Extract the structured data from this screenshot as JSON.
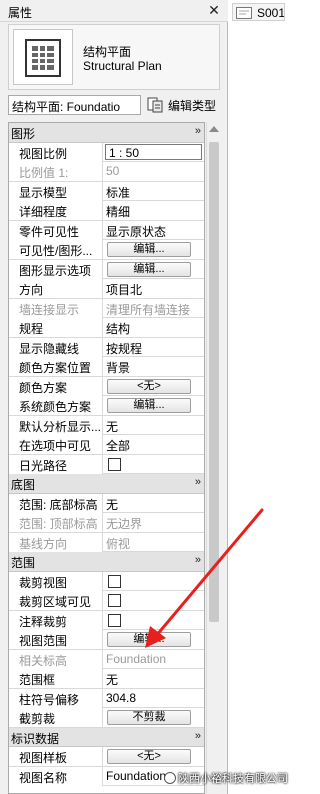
{
  "palette": {
    "title": "属性",
    "close_glyph": "✕",
    "type": {
      "line1": "结构平面",
      "line2": "Structural Plan"
    },
    "selector_value": "结构平面: Foundatio",
    "edit_type_label": "编辑类型"
  },
  "sections": {
    "graphics": {
      "title": "图形",
      "rows": [
        {
          "label": "视图比例",
          "value": "1 : 50"
        },
        {
          "label": "比例值 1:",
          "value": "50"
        },
        {
          "label": "显示模型",
          "value": "标准"
        },
        {
          "label": "详细程度",
          "value": "精细"
        },
        {
          "label": "零件可见性",
          "value": "显示原状态"
        },
        {
          "label": "可见性/图形...",
          "value": "编辑..."
        },
        {
          "label": "图形显示选项",
          "value": "编辑..."
        },
        {
          "label": "方向",
          "value": "项目北"
        },
        {
          "label": "墙连接显示",
          "value": "清理所有墙连接"
        },
        {
          "label": "规程",
          "value": "结构"
        },
        {
          "label": "显示隐藏线",
          "value": "按规程"
        },
        {
          "label": "颜色方案位置",
          "value": "背景"
        },
        {
          "label": "颜色方案",
          "value": "<无>"
        },
        {
          "label": "系统颜色方案",
          "value": "编辑..."
        },
        {
          "label": "默认分析显示...",
          "value": "无"
        },
        {
          "label": "在选项中可见",
          "value": "全部"
        },
        {
          "label": "日光路径",
          "value": ""
        }
      ]
    },
    "underlay": {
      "title": "底图",
      "rows": [
        {
          "label": "范围: 底部标高",
          "value": "无"
        },
        {
          "label": "范围: 顶部标高",
          "value": "无边界"
        },
        {
          "label": "基线方向",
          "value": "俯视"
        }
      ]
    },
    "extents": {
      "title": "范围",
      "rows": [
        {
          "label": "裁剪视图",
          "value": ""
        },
        {
          "label": "裁剪区域可见",
          "value": ""
        },
        {
          "label": "注释裁剪",
          "value": ""
        },
        {
          "label": "视图范围",
          "value": "编辑..."
        },
        {
          "label": "相关标高",
          "value": "Foundation"
        },
        {
          "label": "范围框",
          "value": "无"
        },
        {
          "label": "柱符号偏移",
          "value": "304.8"
        },
        {
          "label": "截剪裁",
          "value": "不剪裁"
        }
      ]
    },
    "identity": {
      "title": "标识数据",
      "rows": [
        {
          "label": "视图样板",
          "value": "<无>"
        },
        {
          "label": "视图名称",
          "value": "Foundation"
        }
      ]
    }
  },
  "collapse_glyph": "»",
  "view_tab_label": "S001",
  "watermark": "陕西小裕科技有限公司",
  "colors": {
    "arrow": "#e8201d",
    "section_bg": "#e3e3e3",
    "panel_bg": "#f0f0f0"
  }
}
